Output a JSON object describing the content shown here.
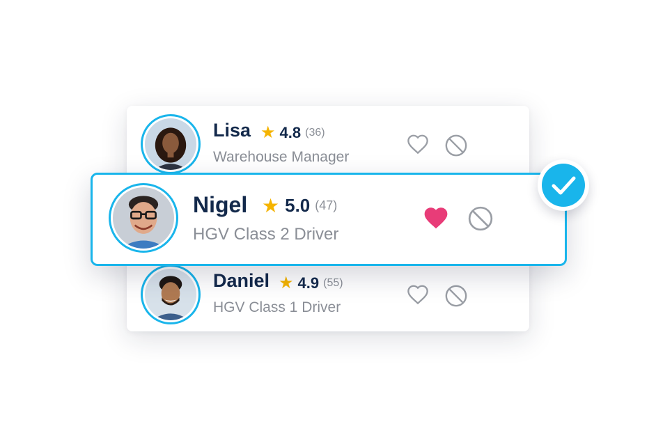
{
  "colors": {
    "accent": "#19b5eb",
    "name": "#13294b",
    "muted": "#8a8e96",
    "star": "#f5b400",
    "heart_active": "#e83c78",
    "icon_inactive": "#9a9ea5"
  },
  "candidates": [
    {
      "name": "Lisa",
      "rating": "4.8",
      "review_count": "(36)",
      "role": "Warehouse Manager",
      "favorited": false,
      "selected": false
    },
    {
      "name": "Nigel",
      "rating": "5.0",
      "review_count": "(47)",
      "role": "HGV Class 2 Driver",
      "favorited": true,
      "selected": true
    },
    {
      "name": "Daniel",
      "rating": "4.9",
      "review_count": "(55)",
      "role": "HGV Class 1 Driver",
      "favorited": false,
      "selected": false
    }
  ],
  "icons": {
    "star": "star-icon",
    "favorite": "heart-icon",
    "block": "block-icon",
    "selected_badge": "checkmark-icon"
  }
}
